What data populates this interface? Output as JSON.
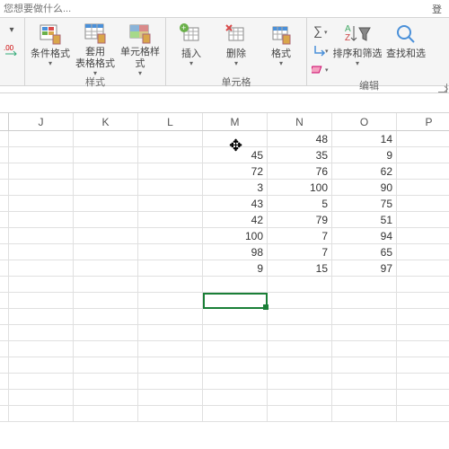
{
  "search": {
    "placeholder": "您想要做什么..."
  },
  "login": "登",
  "ribbon": {
    "left_small": [
      "▾",
      "",
      "⇄"
    ],
    "styles": {
      "cond": "条件格式",
      "table": "套用\n表格格式",
      "cell": "单元格样式",
      "group": "样式"
    },
    "cells": {
      "insert": "插入",
      "delete": "删除",
      "format": "格式",
      "group": "单元格"
    },
    "editing": {
      "sort": "排序和筛选",
      "find": "查找和选",
      "group": "编辑"
    }
  },
  "columns": [
    "J",
    "K",
    "L",
    "M",
    "N",
    "O",
    "P"
  ],
  "grid": [
    [
      "",
      "",
      "",
      "",
      "48",
      "14",
      ""
    ],
    [
      "",
      "",
      "",
      "45",
      "35",
      "9",
      ""
    ],
    [
      "",
      "",
      "",
      "72",
      "76",
      "62",
      ""
    ],
    [
      "",
      "",
      "",
      "3",
      "100",
      "90",
      ""
    ],
    [
      "",
      "",
      "",
      "43",
      "5",
      "75",
      ""
    ],
    [
      "",
      "",
      "",
      "42",
      "79",
      "51",
      ""
    ],
    [
      "",
      "",
      "",
      "100",
      "7",
      "94",
      ""
    ],
    [
      "",
      "",
      "",
      "98",
      "7",
      "65",
      ""
    ],
    [
      "",
      "",
      "",
      "9",
      "15",
      "97",
      ""
    ],
    [
      "",
      "",
      "",
      "",
      "",
      "",
      ""
    ],
    [
      "",
      "",
      "",
      "",
      "",
      "",
      ""
    ],
    [
      "",
      "",
      "",
      "",
      "",
      "",
      ""
    ],
    [
      "",
      "",
      "",
      "",
      "",
      "",
      ""
    ],
    [
      "",
      "",
      "",
      "",
      "",
      "",
      ""
    ],
    [
      "",
      "",
      "",
      "",
      "",
      "",
      ""
    ],
    [
      "",
      "",
      "",
      "",
      "",
      "",
      ""
    ],
    [
      "",
      "",
      "",
      "",
      "",
      "",
      ""
    ],
    [
      "",
      "",
      "",
      "",
      "",
      "",
      ""
    ]
  ],
  "chart_data": {
    "type": "table",
    "columns": [
      "M",
      "N",
      "O"
    ],
    "rows": [
      [
        null,
        48,
        14
      ],
      [
        45,
        35,
        9
      ],
      [
        72,
        76,
        62
      ],
      [
        3,
        100,
        90
      ],
      [
        43,
        5,
        75
      ],
      [
        42,
        79,
        51
      ],
      [
        100,
        7,
        94
      ],
      [
        98,
        7,
        65
      ],
      [
        9,
        15,
        97
      ]
    ]
  }
}
